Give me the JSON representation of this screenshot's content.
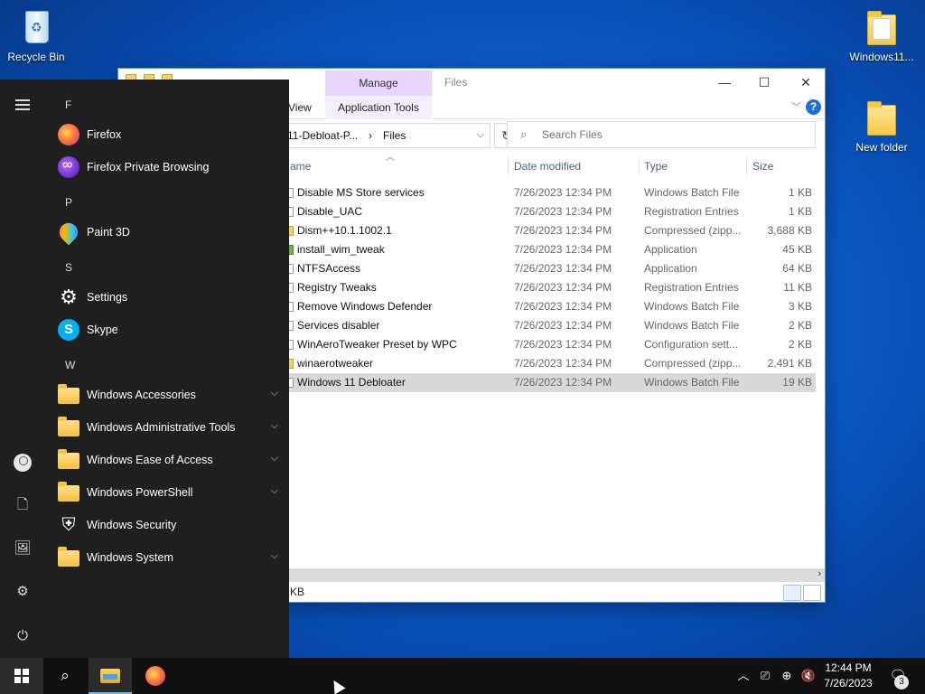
{
  "desktop": {
    "icons": [
      {
        "label": "Recycle Bin"
      },
      {
        "label": "Windows11..."
      },
      {
        "label": "New folder"
      }
    ]
  },
  "explorer": {
    "context_tab": "Manage",
    "title": "Files",
    "ribbon_tabs": [
      "View",
      "Application Tools"
    ],
    "address": {
      "parent": "s11-Debloat-P...",
      "sep": "›",
      "current": "Files"
    },
    "search_placeholder": "Search Files",
    "columns": {
      "name": "ame",
      "date": "Date modified",
      "type": "Type",
      "size": "Size"
    },
    "files": [
      {
        "name": "Disable MS Store services",
        "date": "7/26/2023 12:34 PM",
        "type": "Windows Batch File",
        "size": "1 KB"
      },
      {
        "name": "Disable_UAC",
        "date": "7/26/2023 12:34 PM",
        "type": "Registration Entries",
        "size": "1 KB"
      },
      {
        "name": "Dism++10.1.1002.1",
        "date": "7/26/2023 12:34 PM",
        "type": "Compressed (zipp...",
        "size": "3,688 KB"
      },
      {
        "name": "install_wim_tweak",
        "date": "7/26/2023 12:34 PM",
        "type": "Application",
        "size": "45 KB"
      },
      {
        "name": "NTFSAccess",
        "date": "7/26/2023 12:34 PM",
        "type": "Application",
        "size": "64 KB"
      },
      {
        "name": "Registry Tweaks",
        "date": "7/26/2023 12:34 PM",
        "type": "Registration Entries",
        "size": "11 KB"
      },
      {
        "name": "Remove Windows Defender",
        "date": "7/26/2023 12:34 PM",
        "type": "Windows Batch File",
        "size": "3 KB"
      },
      {
        "name": "Services disabler",
        "date": "7/26/2023 12:34 PM",
        "type": "Windows Batch File",
        "size": "2 KB"
      },
      {
        "name": "WinAeroTweaker Preset by WPC",
        "date": "7/26/2023 12:34 PM",
        "type": "Configuration sett...",
        "size": "2 KB"
      },
      {
        "name": "winaerotweaker",
        "date": "7/26/2023 12:34 PM",
        "type": "Compressed (zipp...",
        "size": "2,491 KB"
      },
      {
        "name": "Windows 11 Debloater",
        "date": "7/26/2023 12:34 PM",
        "type": "Windows Batch File",
        "size": "19 KB"
      }
    ],
    "status": "KB"
  },
  "start_menu": {
    "letters": [
      "F",
      "P",
      "S",
      "W"
    ],
    "apps": [
      {
        "label": "Firefox"
      },
      {
        "label": "Firefox Private Browsing"
      },
      {
        "label": "Paint 3D"
      },
      {
        "label": "Settings"
      },
      {
        "label": "Skype"
      },
      {
        "label": "Windows Accessories"
      },
      {
        "label": "Windows Administrative Tools"
      },
      {
        "label": "Windows Ease of Access"
      },
      {
        "label": "Windows PowerShell"
      },
      {
        "label": "Windows Security"
      },
      {
        "label": "Windows System"
      }
    ]
  },
  "taskbar": {
    "time": "12:44 PM",
    "date": "7/26/2023",
    "notification_count": "3"
  },
  "colors": {
    "accent": "#76b9ed",
    "manage_tab": "#e9d6ff",
    "start_bg": "#1f1f1f"
  }
}
